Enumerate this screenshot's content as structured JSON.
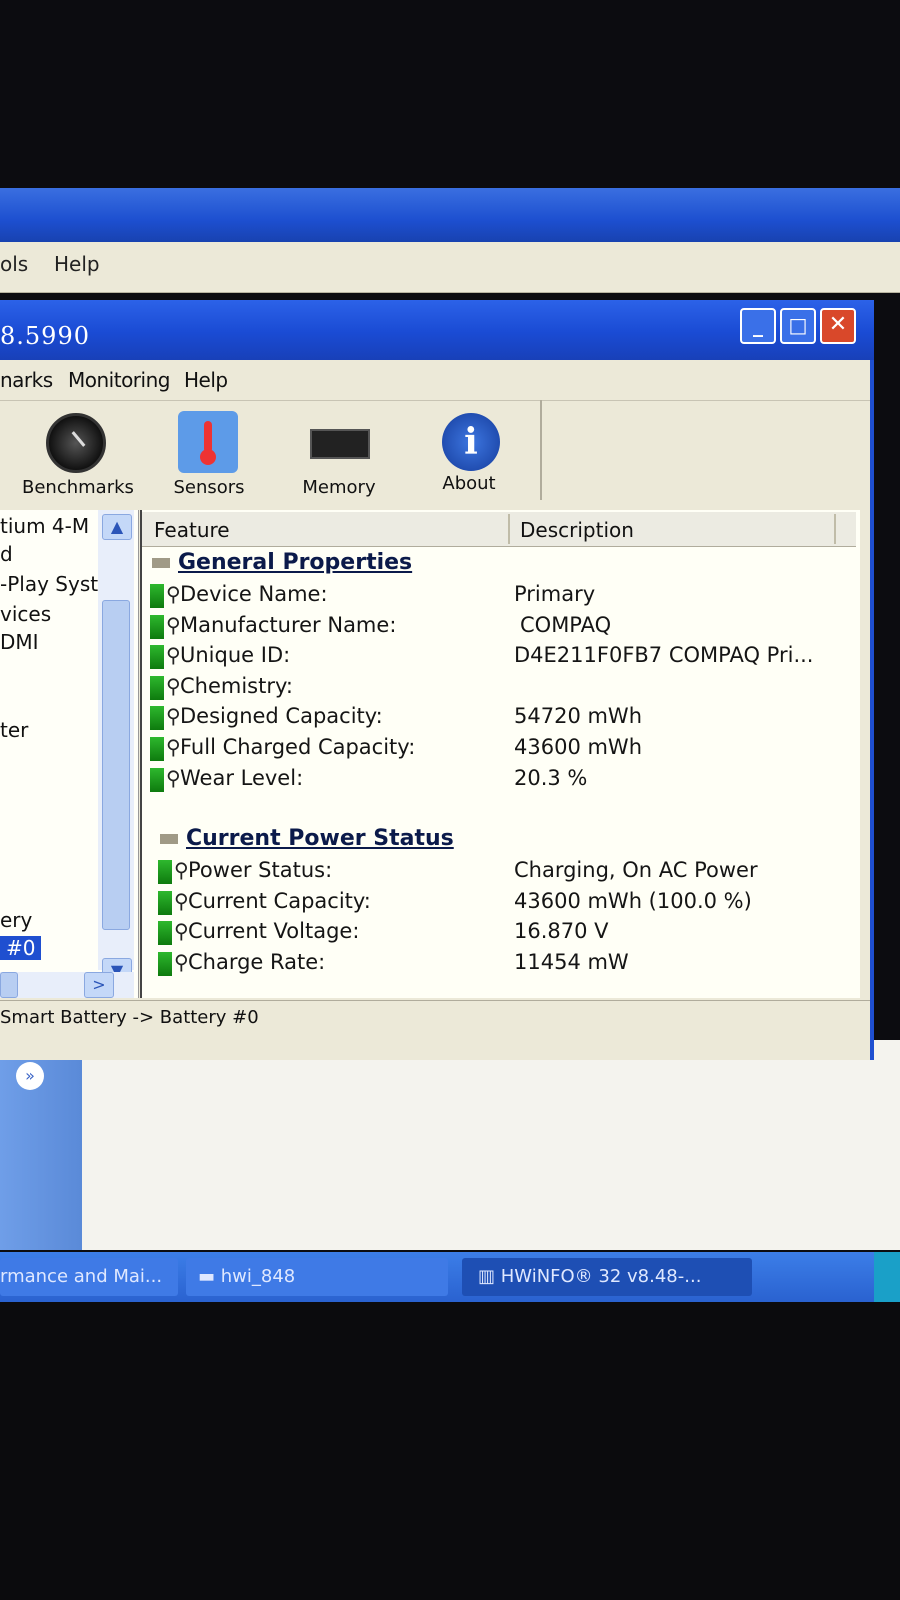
{
  "outer_window": {
    "menu": [
      "ols",
      "Help"
    ]
  },
  "window": {
    "title": "8.5990",
    "controls": {
      "minimize": "_",
      "maximize": "□",
      "close": "✕"
    },
    "menu": [
      "narks",
      "Monitoring",
      "Help"
    ]
  },
  "toolbar": {
    "buttons": [
      {
        "label": "Benchmarks",
        "icon": "gauge-icon"
      },
      {
        "label": "Sensors",
        "icon": "thermometer-icon"
      },
      {
        "label": "Memory",
        "icon": "memory-chip-icon"
      },
      {
        "label": "About",
        "icon": "info-icon"
      }
    ]
  },
  "tree": {
    "items": [
      "tium 4-M",
      "d",
      "-Play Syst",
      "vices",
      " DMI",
      "ter",
      "ery",
      " #0"
    ],
    "selected_index": 7
  },
  "list": {
    "columns": [
      "Feature",
      "Description"
    ],
    "sections": [
      {
        "title": "General Properties",
        "rows": [
          {
            "feature": "Device Name:",
            "value": "Primary"
          },
          {
            "feature": "Manufacturer Name:",
            "value": "COMPAQ"
          },
          {
            "feature": "Unique ID:",
            "value": "D4E211F0FB7 COMPAQ Pri..."
          },
          {
            "feature": "Chemistry:",
            "value": ""
          },
          {
            "feature": "Designed Capacity:",
            "value": "54720 mWh"
          },
          {
            "feature": "Full Charged Capacity:",
            "value": "43600 mWh"
          },
          {
            "feature": "Wear Level:",
            "value": "20.3 %"
          }
        ]
      },
      {
        "title": "Current Power Status",
        "rows": [
          {
            "feature": "Power Status:",
            "value": "Charging, On AC Power"
          },
          {
            "feature": "Current Capacity:",
            "value": "43600 mWh (100.0 %)"
          },
          {
            "feature": "Current Voltage:",
            "value": "16.870 V"
          },
          {
            "feature": "Charge Rate:",
            "value": "11454 mW"
          }
        ]
      }
    ]
  },
  "statusbar": {
    "text": "Smart Battery -> Battery #0"
  },
  "taskbar": {
    "items": [
      "rmance and Mai...",
      "hwi_848",
      "HWiNFO® 32 v8.48-..."
    ]
  },
  "colors": {
    "titlebar": "#1a4bd4",
    "close_button": "#d9482a",
    "taskbar": "#2a62d0",
    "row_icon_green": "#1ea01e"
  }
}
